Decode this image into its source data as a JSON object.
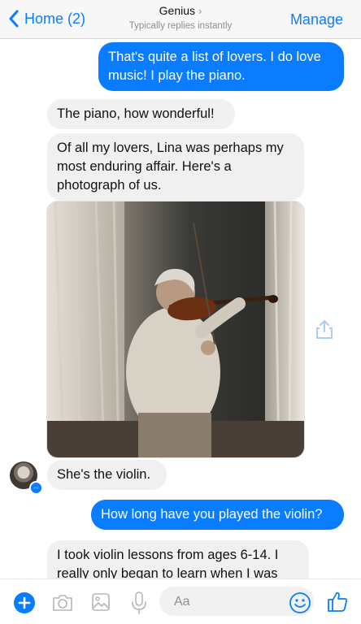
{
  "header": {
    "back_label": "Home (2)",
    "title": "Genius",
    "subtitle": "Typically replies instantly",
    "manage_label": "Manage"
  },
  "messages": [
    {
      "from": "me",
      "text": "That's quite a list of lovers. I do love music! I play the piano."
    },
    {
      "from": "genius",
      "text": "The piano, how wonderful!"
    },
    {
      "from": "genius",
      "text": "Of all my lovers, Lina was perhaps my most enduring affair. Here's a photograph of us."
    },
    {
      "from": "genius",
      "type": "photo"
    },
    {
      "from": "genius",
      "text": "She's the violin."
    },
    {
      "from": "me",
      "text": "How long have you played the violin?"
    },
    {
      "from": "genius",
      "text": "I took violin lessons from ages 6-14. I really only began to learn when I was"
    }
  ],
  "composer": {
    "placeholder": "Aa"
  },
  "colors": {
    "accent": "#0a7cff",
    "incoming_bubble": "#f0f0f0"
  },
  "icons": [
    "chevron-left-icon",
    "chevron-right-icon",
    "plus-icon",
    "camera-icon",
    "image-icon",
    "microphone-icon",
    "emoji-icon",
    "thumbs-up-icon",
    "share-icon"
  ]
}
